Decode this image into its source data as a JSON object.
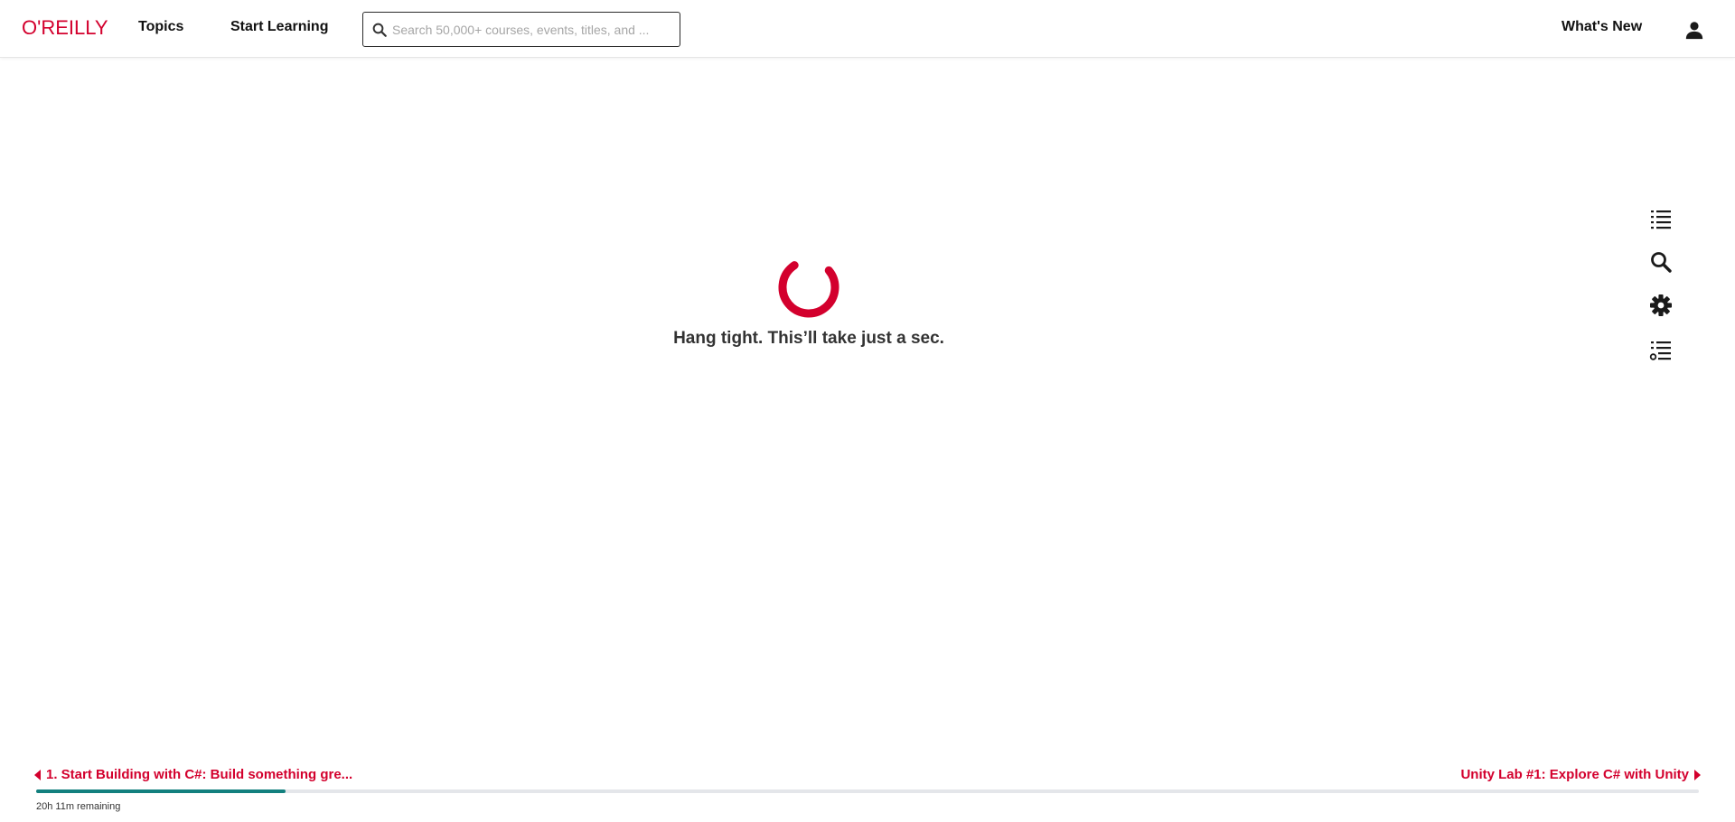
{
  "header": {
    "logo_text": "O'REILLY",
    "nav": {
      "topics": "Topics",
      "start_learning": "Start Learning"
    },
    "search": {
      "placeholder": "Search 50,000+ courses, events, titles, and ...",
      "value": ""
    },
    "whats_new": "What's New",
    "user_icon": "user-icon"
  },
  "main": {
    "loading_text": "Hang tight. This’ll take just a sec.",
    "spinner_color": "#d3002d"
  },
  "side_tools": [
    {
      "name": "table-of-contents-icon"
    },
    {
      "name": "search-icon"
    },
    {
      "name": "gear-icon"
    },
    {
      "name": "playlist-icon"
    }
  ],
  "footer": {
    "prev_label": "1. Start Building with C#: Build something gre...",
    "next_label": "Unity Lab #1: Explore C# with Unity",
    "remaining": "20h 11m remaining",
    "progress_fraction": 0.15
  },
  "colors": {
    "brand": "#d3002d",
    "progress": "#13807e"
  }
}
